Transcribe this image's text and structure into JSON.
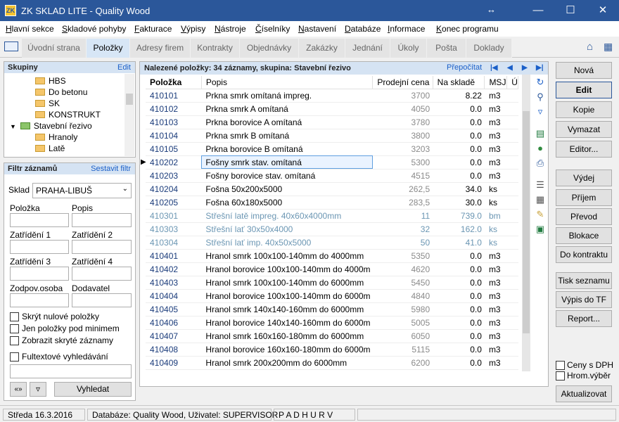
{
  "window": {
    "title": "ZK SKLAD LITE - Quality Wood",
    "app_icon_text": "ZK"
  },
  "menu": [
    "Hlavní sekce",
    "Skladové pohyby",
    "Fakturace",
    "Výpisy",
    "Nástroje",
    "Číselníky",
    "Nastavení",
    "Databáze",
    "Informace",
    "Konec programu"
  ],
  "tabs": [
    "Úvodní strana",
    "Položky",
    "Adresy firem",
    "Kontrakty",
    "Objednávky",
    "Zakázky",
    "Jednání",
    "Úkoly",
    "Pošta",
    "Doklady"
  ],
  "active_tab": "Položky",
  "groups": {
    "title": "Skupiny",
    "edit_link": "Edit",
    "tree": [
      {
        "label": "HBS",
        "level": 2
      },
      {
        "label": "Do betonu",
        "level": 2
      },
      {
        "label": "SK",
        "level": 2
      },
      {
        "label": "KONSTRUKT",
        "level": 2
      },
      {
        "label": "Stavební řezivo",
        "level": 1
      },
      {
        "label": "Hranoly",
        "level": 2
      },
      {
        "label": "Latě",
        "level": 2
      }
    ]
  },
  "filter": {
    "title": "Filtr záznamů",
    "compose_link": "Sestavit filtr",
    "warehouse_label": "Sklad",
    "warehouse_value": "PRAHA-LIBUŠ",
    "fields": {
      "polozka": "Položka",
      "popis": "Popis",
      "zatrideni1": "Zatřídění 1",
      "zatrideni2": "Zatřídění 2",
      "zatrideni3": "Zatřídění 3",
      "zatrideni4": "Zatřídění 4",
      "zodpovosoba": "Zodpov.osoba",
      "dodavatel": "Dodavatel"
    },
    "checkboxes": [
      "Skrýt nulové položky",
      "Jen položky pod minimem",
      "Zobrazit skryté záznamy"
    ],
    "fulltext_label": "Fultextové vyhledávání",
    "search_button": "Vyhledat",
    "clear_button": "«»"
  },
  "grid": {
    "header": "Nalezené položky: 34 záznamy, skupina: Stavební řezivo",
    "recalc_link": "Přepočítat",
    "columns": [
      "Položka",
      "Popis",
      "Prodejní cena",
      "Na skladě",
      "MSJ",
      "Ú"
    ],
    "rows": [
      {
        "code": "410101",
        "desc": "Prkna smrk omítaná impreg.",
        "price": "3700",
        "stock": "8.22",
        "unit": "m3",
        "grey": false
      },
      {
        "code": "410102",
        "desc": "Prkna smrk A omítaná",
        "price": "4050",
        "stock": "0.0",
        "unit": "m3",
        "grey": false
      },
      {
        "code": "410103",
        "desc": "Prkna borovice A omítaná",
        "price": "3780",
        "stock": "0.0",
        "unit": "m3",
        "grey": false
      },
      {
        "code": "410104",
        "desc": "Prkna smrk B omítaná",
        "price": "3800",
        "stock": "0.0",
        "unit": "m3",
        "grey": false
      },
      {
        "code": "410105",
        "desc": "Prkna borovice B omítaná",
        "price": "3203",
        "stock": "0.0",
        "unit": "m3",
        "grey": false
      },
      {
        "code": "410202",
        "desc": "Fošny smrk stav. omítaná",
        "price": "5300",
        "stock": "0.0",
        "unit": "m3",
        "grey": false,
        "selected": true
      },
      {
        "code": "410203",
        "desc": "Fošny borovice stav. omítaná",
        "price": "4515",
        "stock": "0.0",
        "unit": "m3",
        "grey": false
      },
      {
        "code": "410204",
        "desc": "Fošna 50x200x5000",
        "price": "262,5",
        "stock": "34.0",
        "unit": "ks",
        "grey": false
      },
      {
        "code": "410205",
        "desc": "Fošna 60x180x5000",
        "price": "283,5",
        "stock": "30.0",
        "unit": "ks",
        "grey": false
      },
      {
        "code": "410301",
        "desc": "Střešní latě impreg. 40x60x4000mm",
        "price": "11",
        "stock": "739.0",
        "unit": "bm",
        "grey": true
      },
      {
        "code": "410303",
        "desc": "Střešní lať 30x50x4000",
        "price": "32",
        "stock": "162.0",
        "unit": "ks",
        "grey": true
      },
      {
        "code": "410304",
        "desc": "Střešní lať imp. 40x50x5000",
        "price": "50",
        "stock": "41.0",
        "unit": "ks",
        "grey": true
      },
      {
        "code": "410401",
        "desc": "Hranol smrk 100x100-140mm do 4000mm",
        "price": "5350",
        "stock": "0.0",
        "unit": "m3",
        "grey": false
      },
      {
        "code": "410402",
        "desc": "Hranol borovice 100x100-140mm do 4000m",
        "price": "4620",
        "stock": "0.0",
        "unit": "m3",
        "grey": false
      },
      {
        "code": "410403",
        "desc": "Hranol smrk 100x100-140mm do 6000mm",
        "price": "5450",
        "stock": "0.0",
        "unit": "m3",
        "grey": false
      },
      {
        "code": "410404",
        "desc": "Hranol borovice 100x100-140mm do 6000m",
        "price": "4840",
        "stock": "0.0",
        "unit": "m3",
        "grey": false
      },
      {
        "code": "410405",
        "desc": "Hranol smrk 140x140-160mm do 6000mm",
        "price": "5980",
        "stock": "0.0",
        "unit": "m3",
        "grey": false
      },
      {
        "code": "410406",
        "desc": "Hranol borovice 140x140-160mm do 6000m",
        "price": "5005",
        "stock": "0.0",
        "unit": "m3",
        "grey": false
      },
      {
        "code": "410407",
        "desc": "Hranol smrk 160x160-180mm do 6000mm",
        "price": "6050",
        "stock": "0.0",
        "unit": "m3",
        "grey": false
      },
      {
        "code": "410408",
        "desc": "Hranol borovice 160x160-180mm do 6000m",
        "price": "5115",
        "stock": "0.0",
        "unit": "m3",
        "grey": false
      },
      {
        "code": "410409",
        "desc": "Hranol smrk 200x200mm do 6000mm",
        "price": "6200",
        "stock": "0.0",
        "unit": "m3",
        "grey": false
      }
    ]
  },
  "right_buttons": {
    "nova": "Nová",
    "edit": "Edit",
    "kopie": "Kopie",
    "vymazat": "Vymazat",
    "editor": "Editor...",
    "vydej": "Výdej",
    "prijem": "Příjem",
    "prevod": "Převod",
    "blokace": "Blokace",
    "do_kontraktu": "Do kontraktu",
    "tisk": "Tisk seznamu",
    "vypis_tf": "Výpis do TF",
    "report": "Report...",
    "aktualizovat": "Aktualizovat"
  },
  "right_checks": {
    "ceny_dph": "Ceny s DPH",
    "hrom_vyber": "Hrom.výběr"
  },
  "status": {
    "date": "Středa 16.3.2016",
    "db": "Databáze: Quality Wood, Uživatel: SUPERVISOR",
    "flags": "P A D H U R V"
  },
  "colors": {
    "titlebar": "#2b579a",
    "header_bg": "#d5e3f3",
    "link": "#1a5fc8"
  }
}
